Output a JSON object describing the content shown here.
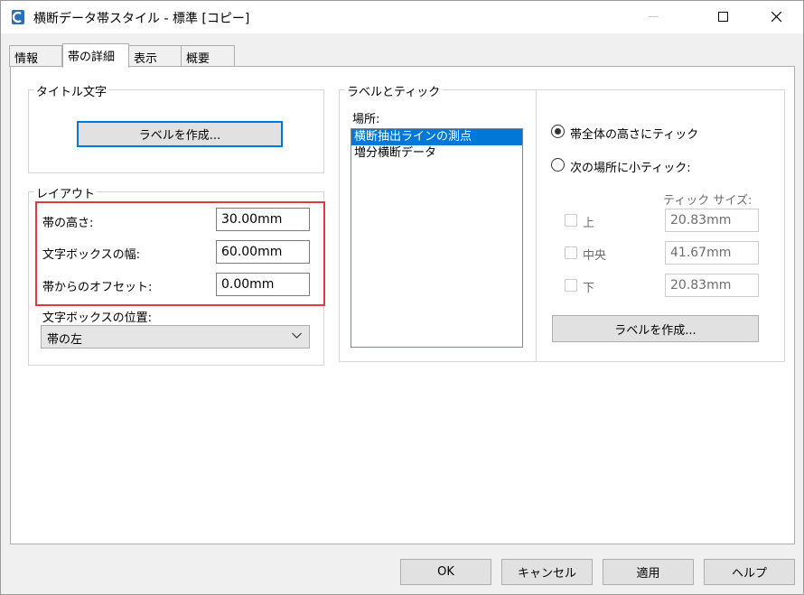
{
  "window": {
    "title": "横断データ帯スタイル - 標準 [コピー]"
  },
  "tabs": [
    {
      "label": "情報"
    },
    {
      "label": "帯の詳細"
    },
    {
      "label": "表示"
    },
    {
      "label": "概要"
    }
  ],
  "title_text_group": {
    "legend": "タイトル文字",
    "create_label_button": "ラベルを作成..."
  },
  "layout_group": {
    "legend": "レイアウト",
    "band_height_label": "帯の高さ:",
    "band_height_value": "30.00mm",
    "textbox_width_label": "文字ボックスの幅:",
    "textbox_width_value": "60.00mm",
    "band_offset_label": "帯からのオフセット:",
    "band_offset_value": "0.00mm",
    "textbox_position_label": "文字ボックスの位置:",
    "textbox_position_value": "帯の左"
  },
  "labels_ticks_group": {
    "legend": "ラベルとティック",
    "location_label": "場所:",
    "locations": [
      {
        "label": "横断抽出ラインの測点",
        "selected": true
      },
      {
        "label": "増分横断データ",
        "selected": false
      }
    ],
    "tick_full_height_label": "帯全体の高さにティック",
    "tick_minor_label": "次の場所に小ティック:",
    "tick_size_header": "ティック サイズ:",
    "tick_rows": [
      {
        "label": "上",
        "value": "20.83mm"
      },
      {
        "label": "中央",
        "value": "41.67mm"
      },
      {
        "label": "下",
        "value": "20.83mm"
      }
    ],
    "create_label_button": "ラベルを作成..."
  },
  "footer": {
    "ok": "OK",
    "cancel": "キャンセル",
    "apply": "適用",
    "help": "ヘルプ"
  },
  "colors": {
    "accent": "#0078d7",
    "highlight_box": "#e03a3e"
  }
}
